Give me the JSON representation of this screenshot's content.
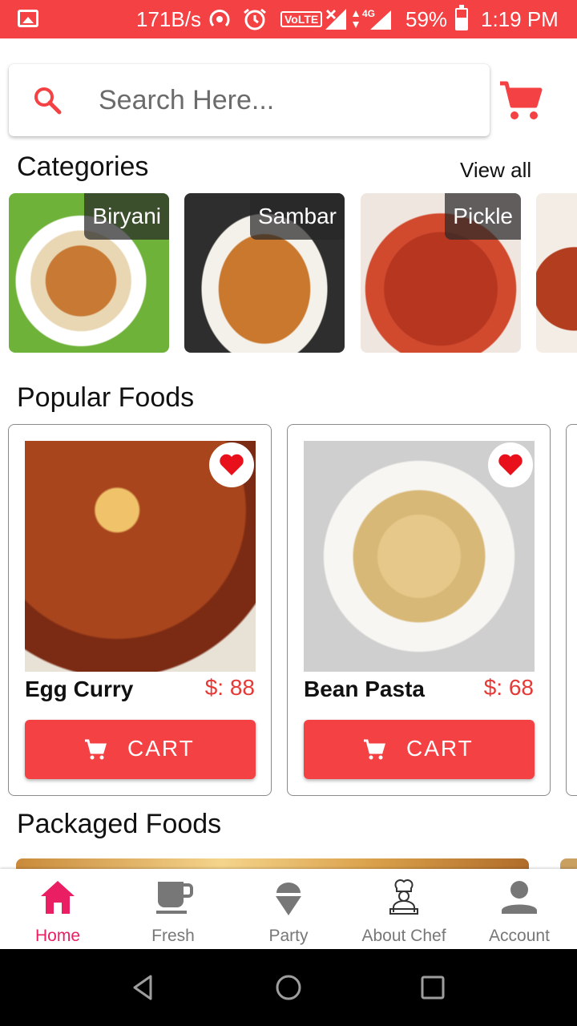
{
  "status_bar": {
    "speed": "171B/s",
    "volte": "VoLTE",
    "network": "4G",
    "battery_pct": "59%",
    "battery_level": 0.59,
    "time": "1:19 PM",
    "color": "#f44244"
  },
  "search": {
    "placeholder": "Search Here..."
  },
  "categories": {
    "title": "Categories",
    "view_all": "View all",
    "items": [
      {
        "label": "Biryani"
      },
      {
        "label": "Sambar"
      },
      {
        "label": "Pickle"
      }
    ]
  },
  "popular": {
    "title": "Popular Foods",
    "items": [
      {
        "name": "Egg Curry",
        "price": "$: 88",
        "cart_label": "CART"
      },
      {
        "name": "Bean Pasta",
        "price": "$: 68",
        "cart_label": "CART"
      }
    ]
  },
  "packaged": {
    "title": "Packaged Foods"
  },
  "bottom_nav": {
    "items": [
      {
        "label": "Home",
        "icon": "home-icon",
        "active": true
      },
      {
        "label": "Fresh",
        "icon": "cup-icon",
        "active": false
      },
      {
        "label": "Party",
        "icon": "ice-cream-icon",
        "active": false
      },
      {
        "label": "About Chef",
        "icon": "chef-icon",
        "active": false
      },
      {
        "label": "Account",
        "icon": "account-icon",
        "active": false
      }
    ]
  },
  "colors": {
    "accent": "#f44244",
    "price": "#e53935",
    "active_nav": "#e91e63",
    "inactive_nav": "#777777"
  }
}
